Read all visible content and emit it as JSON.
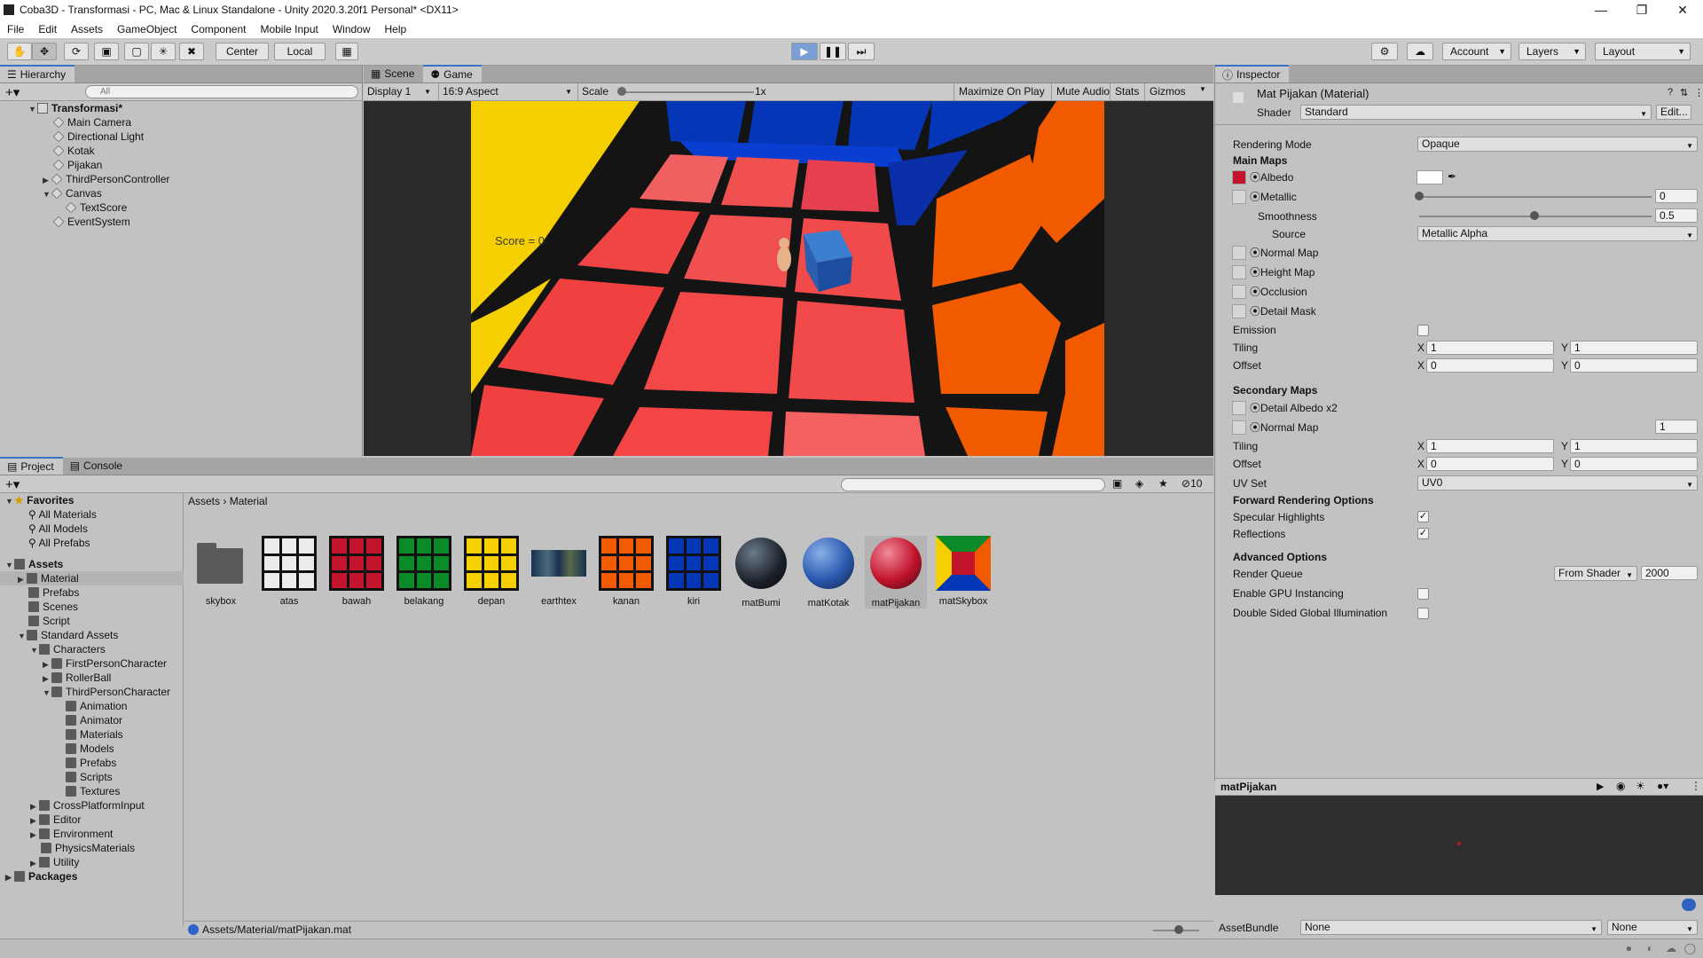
{
  "window": {
    "title": "Coba3D - Transformasi - PC, Mac & Linux Standalone - Unity 2020.3.20f1 Personal* <DX11>"
  },
  "menu": [
    "File",
    "Edit",
    "Assets",
    "GameObject",
    "Component",
    "Mobile Input",
    "Window",
    "Help"
  ],
  "toolbar": {
    "pivot_label": "Center",
    "space_label": "Local",
    "account_label": "Account",
    "layers_label": "Layers",
    "layout_label": "Layout"
  },
  "hierarchy": {
    "tab": "Hierarchy",
    "search_placeholder": "All",
    "scene": "Transformasi*",
    "items": [
      "Main Camera",
      "Directional Light",
      "Kotak",
      "Pijakan",
      "ThirdPersonController",
      "Canvas",
      "TextScore",
      "EventSystem"
    ]
  },
  "game": {
    "tabs": [
      "Scene",
      "Game"
    ],
    "display": "Display 1",
    "aspect": "16:9 Aspect",
    "scale_label": "Scale",
    "scale_value": "1x",
    "buttons": [
      "Maximize On Play",
      "Mute Audio",
      "Stats",
      "Gizmos"
    ],
    "score_text": "Score = 0"
  },
  "inspector": {
    "tab": "Inspector",
    "title": "Mat Pijakan (Material)",
    "shader_label": "Shader",
    "shader_value": "Standard",
    "edit_button": "Edit...",
    "rendering_mode_label": "Rendering Mode",
    "rendering_mode_value": "Opaque",
    "main_maps": "Main Maps",
    "albedo": "Albedo",
    "metallic": "Metallic",
    "metallic_value": "0",
    "smoothness": "Smoothness",
    "smoothness_value": "0.5",
    "source": "Source",
    "source_value": "Metallic Alpha",
    "normal_map": "Normal Map",
    "height_map": "Height Map",
    "occlusion": "Occlusion",
    "detail_mask": "Detail Mask",
    "emission": "Emission",
    "tiling": "Tiling",
    "offset": "Offset",
    "tiling_x": "1",
    "tiling_y": "1",
    "offset_x": "0",
    "offset_y": "0",
    "secondary_maps": "Secondary Maps",
    "detail_albedo": "Detail Albedo x2",
    "normal_map2": "Normal Map",
    "normal_map2_value": "1",
    "tiling2_x": "1",
    "tiling2_y": "1",
    "offset2_x": "0",
    "offset2_y": "0",
    "uv_set": "UV Set",
    "uv_set_value": "UV0",
    "forward_options": "Forward Rendering Options",
    "specular": "Specular Highlights",
    "reflections": "Reflections",
    "advanced": "Advanced Options",
    "render_queue": "Render Queue",
    "render_queue_mode": "From Shader",
    "render_queue_value": "2000",
    "gpu_instancing": "Enable GPU Instancing",
    "double_sided": "Double Sided Global Illumination",
    "preview_title": "matPijakan",
    "assetbundle_label": "AssetBundle",
    "assetbundle_value": "None",
    "assetbundle_variant": "None",
    "x": "X",
    "y": "Y"
  },
  "project": {
    "tabs": [
      "Project",
      "Console"
    ],
    "hidden_count": "10",
    "breadcrumb": [
      "Assets",
      "Material"
    ],
    "favorites": "Favorites",
    "fav_items": [
      "All Materials",
      "All Models",
      "All Prefabs"
    ],
    "assets_root": "Assets",
    "tree": [
      "Material",
      "Prefabs",
      "Scenes",
      "Script",
      "Standard Assets",
      "Characters",
      "FirstPersonCharacter",
      "RollerBall",
      "ThirdPersonCharacter",
      "Animation",
      "Animator",
      "Materials",
      "Models",
      "Prefabs",
      "Scripts",
      "Textures",
      "CrossPlatformInput",
      "Editor",
      "Environment",
      "PhysicsMaterials",
      "Utility"
    ],
    "packages": "Packages",
    "assets": [
      "skybox",
      "atas",
      "bawah",
      "belakang",
      "depan",
      "earthtex",
      "kanan",
      "kiri",
      "matBumi",
      "matKotak",
      "matPijakan",
      "matSkybox"
    ],
    "status_path": "Assets/Material/matPijakan.mat"
  },
  "colors": {
    "accent": "#3a72c6",
    "white_face": "#ececec",
    "red_face": "#c2142c",
    "green_face": "#0b8a2a",
    "yellow_face": "#f5cf00",
    "orange_face": "#f25a00",
    "blue_face": "#0636b8",
    "floor_red": "#f04040"
  }
}
